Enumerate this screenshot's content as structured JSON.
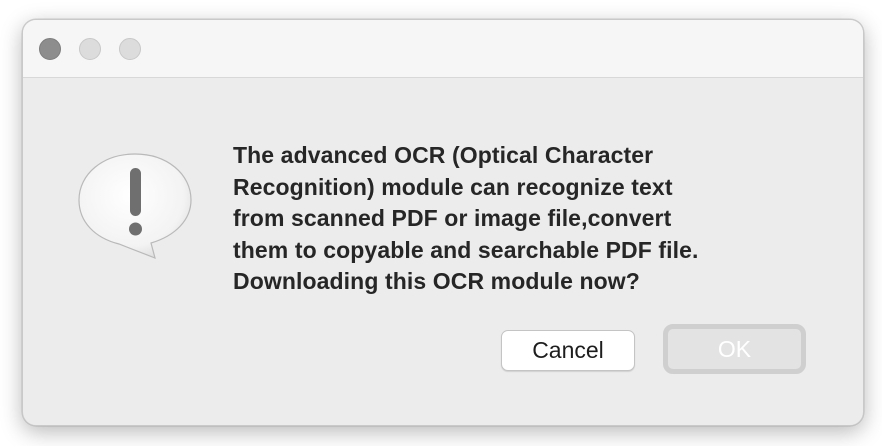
{
  "dialog": {
    "message_lines": [
      "The advanced OCR (Optical Character",
      "Recognition) module can recognize text",
      "from scanned PDF or image file,convert",
      "them to copyable and searchable PDF file.",
      "Downloading this OCR module now?"
    ],
    "buttons": {
      "cancel_label": "Cancel",
      "ok_label": "OK"
    },
    "icon": "alert-caution-icon"
  },
  "titlebar": {
    "controls": [
      "close",
      "minimize",
      "zoom"
    ]
  },
  "colors": {
    "window_bg": "#ececec",
    "titlebar_bg": "#f6f6f6",
    "text": "#262626",
    "ok_disabled_text": "#ffffff"
  }
}
